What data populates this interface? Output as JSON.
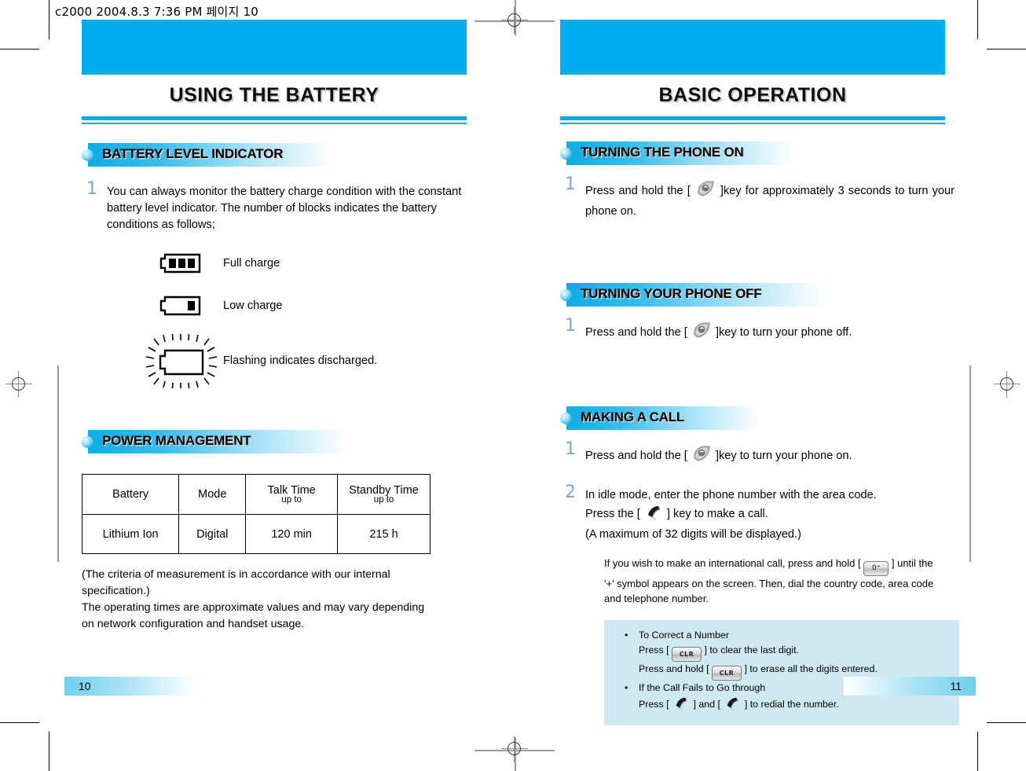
{
  "file_header": "c2000  2004.8.3 7:36 PM  페이지 10",
  "colors": {
    "accent": "#00aeef",
    "tip_box": "#cfe9f2",
    "step_number": "#7ea5d8"
  },
  "left_page": {
    "chapter_title": "USING THE BATTERY",
    "page_number": "10",
    "sections": [
      {
        "heading": "BATTERY LEVEL INDICATOR"
      },
      {
        "heading": "POWER MANAGEMENT"
      }
    ],
    "step1": {
      "number": "1",
      "text": "You can always monitor the battery charge condition with the constant battery level indicator. The number of blocks indicates the battery conditions as follows;"
    },
    "battery_states": [
      {
        "icon": "battery-full-icon",
        "label": "Full charge"
      },
      {
        "icon": "battery-low-icon",
        "label": "Low charge"
      },
      {
        "icon": "battery-flashing-icon",
        "label": "Flashing indicates discharged."
      }
    ],
    "table": {
      "headers": [
        "Battery",
        "Mode",
        "Talk Time",
        "Standby Time"
      ],
      "subheaders": [
        "",
        "",
        "up to",
        "up to"
      ],
      "rows": [
        [
          "Lithium Ion",
          "Digital",
          "120 min",
          "215 h"
        ]
      ]
    },
    "notes": [
      "(The criteria of measurement is in accordance with our internal",
      " specification.)",
      "The operating times are approximate values and may vary depending",
      "on network configuration and handset usage."
    ]
  },
  "right_page": {
    "chapter_title": "BASIC OPERATION",
    "page_number": "11",
    "sections": [
      {
        "heading": "TURNING THE PHONE ON",
        "steps": [
          {
            "number": "1",
            "before": "Press and hold the [",
            "icon": "power-key-icon",
            "after": "]key for approximately 3 seconds to turn your phone on."
          }
        ]
      },
      {
        "heading": "TURNING YOUR PHONE OFF",
        "steps": [
          {
            "number": "1",
            "before": "Press and hold the [",
            "icon": "power-key-icon",
            "after": "]key to turn your phone off."
          }
        ]
      },
      {
        "heading": "MAKING A CALL",
        "steps": [
          {
            "number": "1",
            "before": "Press and hold the [",
            "icon": "power-key-icon",
            "after": "]key to turn your phone on."
          },
          {
            "number": "2",
            "line1": "In idle mode, enter the phone number with the area code.",
            "line2_before": "Press the [",
            "line2_icon": "send-key-icon",
            "line2_after": "] key to make a call.",
            "line3": "(A maximum of 32 digits will be displayed.)"
          }
        ]
      }
    ],
    "subnote": {
      "part1": "If you wish to make an international call, press and hold [",
      "key_label": "0",
      "key_icon": "zero-key-icon",
      "part2": "] until the '+' symbol appears on the screen. Then, dial the country code, area code and telephone number."
    },
    "tip_box": {
      "bullet": "•",
      "items": [
        {
          "title": "To Correct a Number",
          "lines": [
            {
              "before": "Press [",
              "key": "CLR",
              "after": "] to clear the last digit."
            },
            {
              "before": "Press and hold [",
              "key": "CLR",
              "after": "] to erase all the digits entered."
            }
          ]
        },
        {
          "title": "If the Call Fails to Go through",
          "lines": [
            {
              "before": "Press [",
              "icon": "send-key-icon",
              "mid": "] and [",
              "icon2": "send-key-icon",
              "after": "] to redial the number."
            }
          ]
        }
      ]
    }
  }
}
